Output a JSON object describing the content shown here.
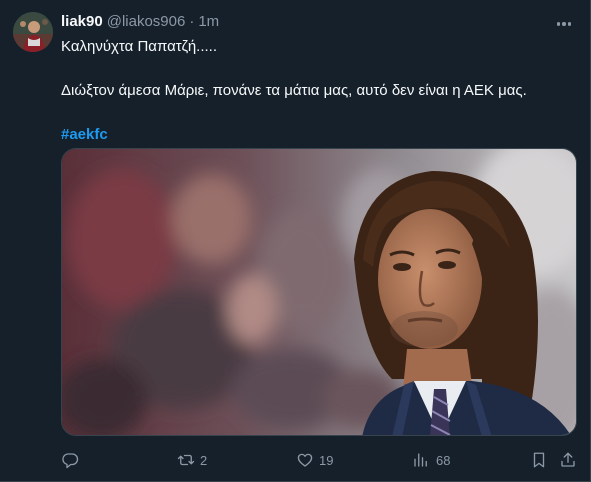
{
  "tweet": {
    "author_name": "liak90",
    "handle": "@liakos906",
    "separator": "·",
    "time": "1m",
    "lines": [
      "Καληνύχτα Παπατζή.....",
      "Διώξτον άμεσα Μάριε, πονάνε τα μάτια μας, αυτό δεν είναι η ΑΕΚ μας."
    ],
    "hashtag": "#aekfc"
  },
  "actions": {
    "reply_count": "",
    "retweet_count": "2",
    "like_count": "19",
    "views_count": "68"
  },
  "icons": {
    "more": "more-dots-icon",
    "reply": "reply-icon",
    "retweet": "retweet-icon",
    "like": "heart-icon",
    "views": "views-chart-icon",
    "bookmark": "bookmark-icon",
    "share": "share-icon"
  },
  "colors": {
    "background": "#15202b",
    "text": "#f7f9f9",
    "muted": "#8b98a5",
    "link": "#1d9bf0",
    "border": "#38444d"
  }
}
